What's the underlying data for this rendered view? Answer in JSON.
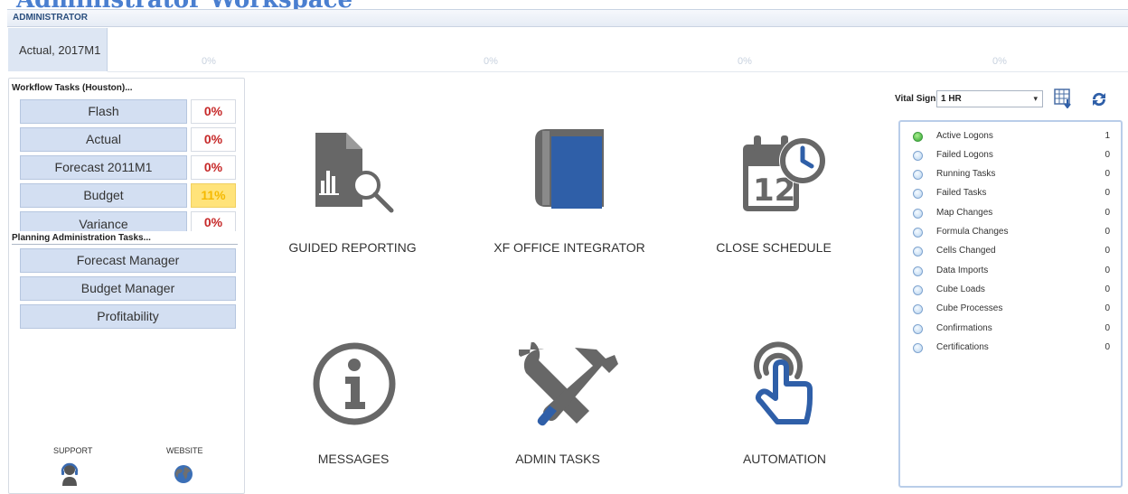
{
  "page": {
    "title": "Administrator Workspace"
  },
  "header": {
    "section_label": "ADMINISTRATOR",
    "period_label": "Actual,  2017M1",
    "top_percents": [
      "0%",
      "0%",
      "0%",
      "0%"
    ]
  },
  "workflow": {
    "title": "Workflow Tasks (Houston)...",
    "items": [
      {
        "label": "Flash",
        "percent": "0%"
      },
      {
        "label": "Actual",
        "percent": "0%"
      },
      {
        "label": "Forecast 2011M1",
        "percent": "0%"
      },
      {
        "label": "Budget",
        "percent": "11%"
      },
      {
        "label": "Variance",
        "percent": "0%"
      }
    ]
  },
  "planning": {
    "title": "Planning Administration Tasks...",
    "items": [
      {
        "label": "Forecast Manager"
      },
      {
        "label": "Budget Manager"
      },
      {
        "label": "Profitability"
      }
    ]
  },
  "footer": {
    "support_label": "SUPPORT",
    "website_label": "WEBSITE"
  },
  "tiles": [
    {
      "label": "GUIDED REPORTING",
      "icon": "report-search-icon"
    },
    {
      "label": "XF OFFICE INTEGRATOR",
      "icon": "book-icon"
    },
    {
      "label": "CLOSE SCHEDULE",
      "icon": "calendar-clock-icon"
    },
    {
      "label": "MESSAGES",
      "icon": "info-icon"
    },
    {
      "label": "ADMIN TASKS",
      "icon": "tools-icon"
    },
    {
      "label": "AUTOMATION",
      "icon": "touch-icon"
    }
  ],
  "vital_signs": {
    "label": "Vital Signs:",
    "selected": "1 HR",
    "items": [
      {
        "name": "Active Logons",
        "value": "1",
        "active": true
      },
      {
        "name": "Failed Logons",
        "value": "0",
        "active": false
      },
      {
        "name": "Running Tasks",
        "value": "0",
        "active": false
      },
      {
        "name": "Failed Tasks",
        "value": "0",
        "active": false
      },
      {
        "name": "Map Changes",
        "value": "0",
        "active": false
      },
      {
        "name": "Formula Changes",
        "value": "0",
        "active": false
      },
      {
        "name": "Cells Changed",
        "value": "0",
        "active": false
      },
      {
        "name": "Data Imports",
        "value": "0",
        "active": false
      },
      {
        "name": "Cube Loads",
        "value": "0",
        "active": false
      },
      {
        "name": "Cube Processes",
        "value": "0",
        "active": false
      },
      {
        "name": "Confirmations",
        "value": "0",
        "active": false
      },
      {
        "name": "Certifications",
        "value": "0",
        "active": false
      }
    ]
  },
  "colors": {
    "title_blue": "#4a7fd0",
    "icon_gray": "#676767",
    "icon_blue": "#2f5fa8",
    "pct_red": "#c62828",
    "pct_highlight_bg": "#ffe37a",
    "pct_highlight_text": "#f5b900",
    "status_green": "#2fa32f"
  }
}
